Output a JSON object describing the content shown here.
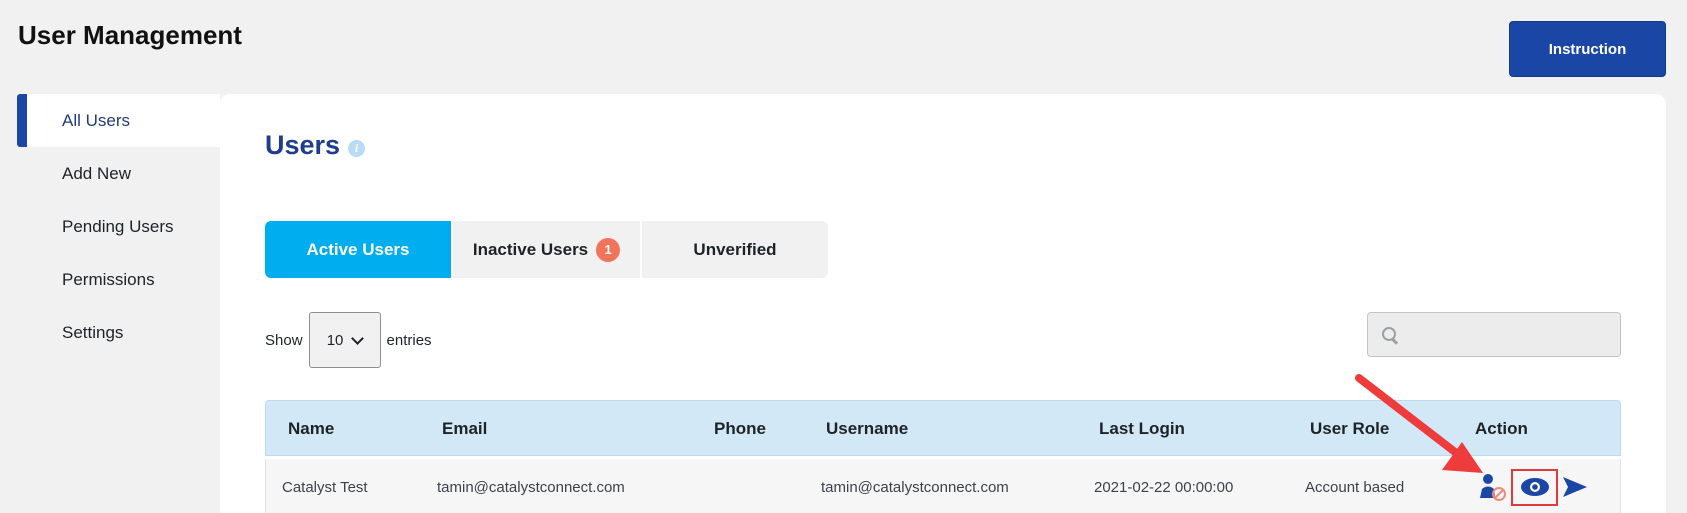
{
  "header": {
    "title": "User Management",
    "instruction_label": "Instruction"
  },
  "sidebar": {
    "items": [
      {
        "label": "All Users",
        "active": true
      },
      {
        "label": "Add New"
      },
      {
        "label": "Pending Users"
      },
      {
        "label": "Permissions"
      },
      {
        "label": "Settings"
      }
    ]
  },
  "main": {
    "title": "Users",
    "info_icon": "i",
    "tabs": [
      {
        "label": "Active Users",
        "active": true
      },
      {
        "label": "Inactive Users",
        "badge": "1"
      },
      {
        "label": "Unverified"
      }
    ],
    "length": {
      "show": "Show",
      "value": "10",
      "entries": "entries"
    },
    "search": {
      "placeholder": ""
    },
    "table": {
      "columns": [
        "Name",
        "Email",
        "Phone",
        "Username",
        "Last Login",
        "User Role",
        "Action"
      ],
      "rows": [
        {
          "name": "Catalyst Test",
          "email": "tamin@catalystconnect.com",
          "phone": "",
          "username": "tamin@catalystconnect.com",
          "last_login": "2021-02-22 00:00:00",
          "role": "Account based",
          "actions": [
            "deactivate-user-icon",
            "view-icon",
            "send-icon"
          ]
        }
      ]
    }
  },
  "colors": {
    "primary": "#1a47a5",
    "tab_active": "#00adee",
    "badge": "#f0735a",
    "table_header": "#d3e8f6",
    "highlight": "#e03a3a"
  }
}
